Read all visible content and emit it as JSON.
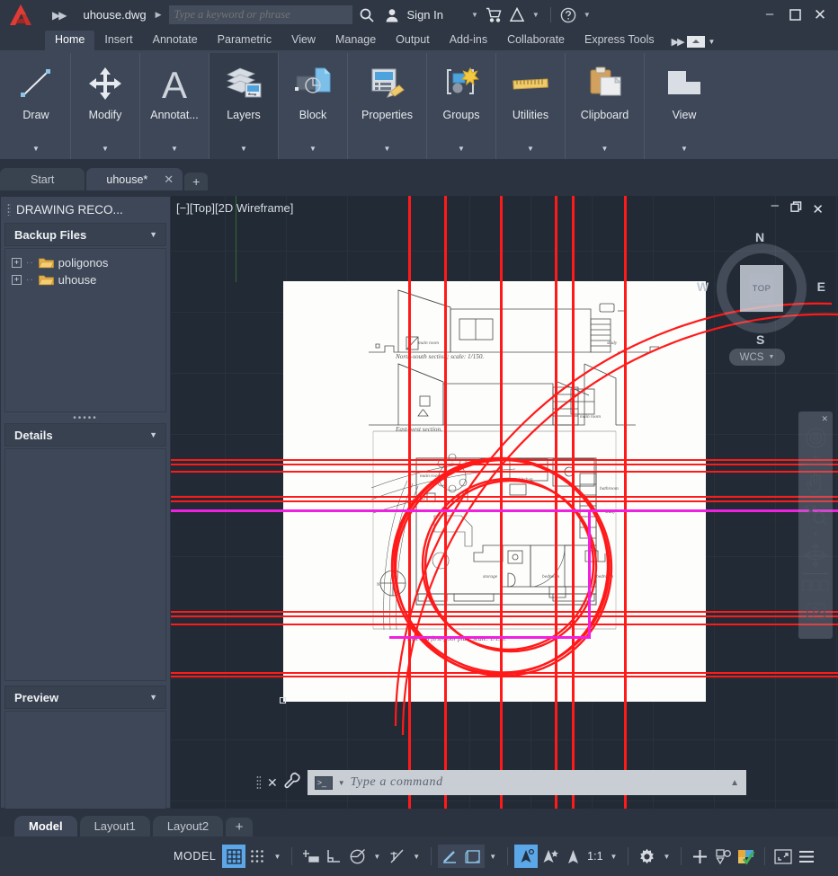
{
  "titlebar": {
    "document_name": "uhouse.dwg",
    "search_placeholder": "Type a keyword or phrase",
    "sign_in": "Sign In",
    "icons": [
      "autocad-logo",
      "quick-access-chevron",
      "search-icon",
      "user-icon",
      "cart-icon",
      "autodesk-app-icon",
      "help-icon"
    ],
    "window_minimize": "–",
    "window_maximize": "☐",
    "window_close": "✕"
  },
  "ribbon": {
    "tabs": [
      {
        "label": "Home",
        "active": true
      },
      {
        "label": "Insert",
        "active": false
      },
      {
        "label": "Annotate",
        "active": false
      },
      {
        "label": "Parametric",
        "active": false
      },
      {
        "label": "View",
        "active": false
      },
      {
        "label": "Manage",
        "active": false
      },
      {
        "label": "Output",
        "active": false
      },
      {
        "label": "Add-ins",
        "active": false
      },
      {
        "label": "Collaborate",
        "active": false
      },
      {
        "label": "Express Tools",
        "active": false
      }
    ],
    "panels": [
      {
        "label": "Draw",
        "icon": "line-icon"
      },
      {
        "label": "Modify",
        "icon": "move-arrows-icon"
      },
      {
        "label": "Annotat...",
        "icon": "text-a-icon"
      },
      {
        "label": "Layers",
        "icon": "layers-icon"
      },
      {
        "label": "Block",
        "icon": "block-icon"
      },
      {
        "label": "Properties",
        "icon": "properties-icon"
      },
      {
        "label": "Groups",
        "icon": "group-star-icon"
      },
      {
        "label": "Utilities",
        "icon": "ruler-icon"
      },
      {
        "label": "Clipboard",
        "icon": "clipboard-icon"
      },
      {
        "label": "View",
        "icon": "view-shape-icon"
      }
    ]
  },
  "file_tabs": [
    {
      "label": "Start",
      "active": false,
      "closable": false
    },
    {
      "label": "uhouse*",
      "active": true,
      "closable": true
    }
  ],
  "file_tab_add": "+",
  "palette": {
    "title": "DRAWING RECO...",
    "sections": [
      {
        "label": "Backup Files",
        "caret": "▼"
      },
      {
        "label": "Details",
        "caret": "▼"
      },
      {
        "label": "Preview",
        "caret": "▼"
      }
    ],
    "tree_items": [
      {
        "label": "poligonos",
        "expander": "+"
      },
      {
        "label": "uhouse",
        "expander": "+"
      }
    ]
  },
  "viewport": {
    "label": "[−][Top][2D Wireframe]",
    "controls": {
      "minimize": "–",
      "restore": "❐",
      "close": "✕"
    },
    "viewcube": {
      "face": "TOP",
      "north": "N",
      "south": "S",
      "east": "E",
      "west": "W"
    },
    "wcs": "WCS",
    "navbar_icons": [
      "steering-wheel-icon",
      "pan-hand-icon",
      "zoom-extents-icon",
      "orbit-icon",
      "showmotion-icon"
    ],
    "drawing": {
      "section_label_1": "North-south section; scale:   1/150.",
      "section_label_2": "East-west section.",
      "plan_label": "Plot and first-floor plan; scale:   1/150.",
      "room_labels": [
        "main room",
        "study",
        "bathroom",
        "kitchen",
        "main room",
        "storage",
        "bedroom",
        "bedroom",
        "study"
      ],
      "north_mark": "N"
    },
    "colors": {
      "selection_red": "#ff1a1a",
      "selection_magenta": "#f020e0",
      "canvas_bg": "#222a36",
      "paper": "#fdfdfc",
      "axis_green": "#2e6b2e"
    }
  },
  "command_line": {
    "placeholder": "Type a command",
    "close_icon": "✕",
    "wrench_icon": "wrench-icon",
    "expand_caret": "▲"
  },
  "layout_tabs": [
    {
      "label": "Model",
      "active": true
    },
    {
      "label": "Layout1",
      "active": false
    },
    {
      "label": "Layout2",
      "active": false
    }
  ],
  "layout_tab_add": "+",
  "statusbar": {
    "space_label": "MODEL",
    "scale": "1:1",
    "items": [
      {
        "name": "grid-display",
        "on": true
      },
      {
        "name": "snap-mode",
        "on": false
      },
      {
        "name": "infer-constraints",
        "on": false
      },
      {
        "name": "ortho-mode",
        "on": false
      },
      {
        "name": "polar-tracking",
        "on": false
      },
      {
        "name": "object-snap-tracking",
        "on": false
      },
      {
        "name": "object-snap",
        "on": false
      },
      {
        "name": "lineweight",
        "on": false
      },
      {
        "name": "transparency",
        "on": false
      },
      {
        "name": "selection-cycling",
        "on": true
      },
      {
        "name": "annotation-visibility",
        "on": false
      },
      {
        "name": "autoscale",
        "on": false
      },
      {
        "name": "workspace-switching",
        "on": false
      },
      {
        "name": "annotation-monitor",
        "on": false
      },
      {
        "name": "isolate-objects",
        "on": false
      },
      {
        "name": "fullscreen",
        "on": false
      },
      {
        "name": "customization",
        "on": false
      }
    ],
    "accent_on": "#5ba7e8"
  }
}
